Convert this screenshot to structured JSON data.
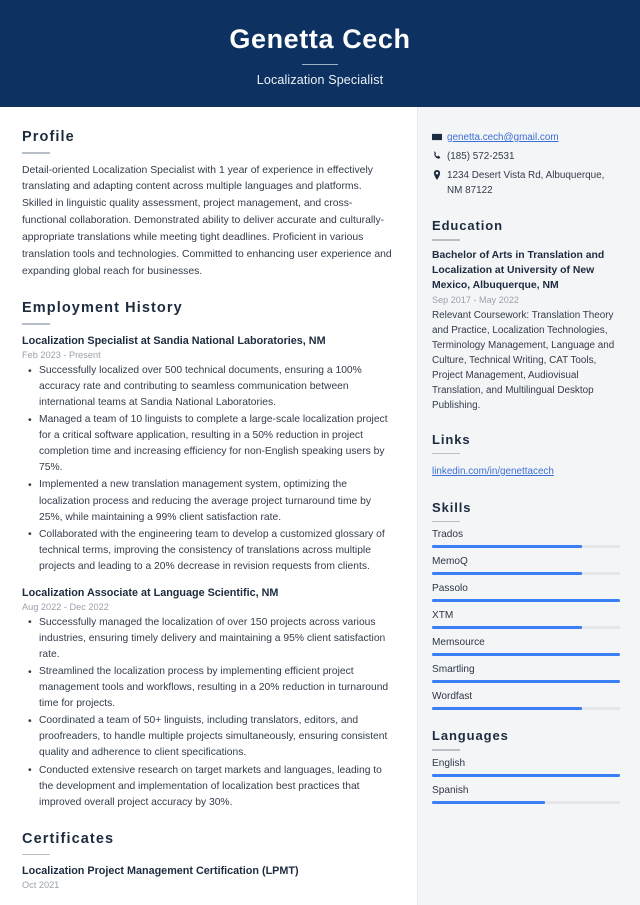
{
  "header": {
    "name": "Genetta Cech",
    "job_title": "Localization Specialist"
  },
  "theme": {
    "navy": "#0d3261",
    "sidebar_bg": "#f4f5f7",
    "accent_blue": "#3b7ff5",
    "link_blue": "#3b6fd4",
    "track_gray": "#e4e6e8"
  },
  "main": {
    "profile": {
      "heading": "Profile",
      "text": "Detail-oriented Localization Specialist with 1 year of experience in effectively translating and adapting content across multiple languages and platforms. Skilled in linguistic quality assessment, project management, and cross-functional collaboration. Demonstrated ability to deliver accurate and culturally-appropriate translations while meeting tight deadlines. Proficient in various translation tools and technologies. Committed to enhancing user experience and expanding global reach for businesses."
    },
    "employment": {
      "heading": "Employment History",
      "jobs": [
        {
          "title": "Localization Specialist at Sandia National Laboratories, NM",
          "date": "Feb 2023 - Present",
          "bullets": [
            "Successfully localized over 500 technical documents, ensuring a 100% accuracy rate and contributing to seamless communication between international teams at Sandia National Laboratories.",
            "Managed a team of 10 linguists to complete a large-scale localization project for a critical software application, resulting in a 50% reduction in project completion time and increasing efficiency for non-English speaking users by 75%.",
            "Implemented a new translation management system, optimizing the localization process and reducing the average project turnaround time by 25%, while maintaining a 99% client satisfaction rate.",
            "Collaborated with the engineering team to develop a customized glossary of technical terms, improving the consistency of translations across multiple projects and leading to a 20% decrease in revision requests from clients."
          ]
        },
        {
          "title": "Localization Associate at Language Scientific, NM",
          "date": "Aug 2022 - Dec 2022",
          "bullets": [
            "Successfully managed the localization of over 150 projects across various industries, ensuring timely delivery and maintaining a 95% client satisfaction rate.",
            "Streamlined the localization process by implementing efficient project management tools and workflows, resulting in a 20% reduction in turnaround time for projects.",
            "Coordinated a team of 50+ linguists, including translators, editors, and proofreaders, to handle multiple projects simultaneously, ensuring consistent quality and adherence to client specifications.",
            "Conducted extensive research on target markets and languages, leading to the development and implementation of localization best practices that improved overall project accuracy by 30%."
          ]
        }
      ]
    },
    "certificates": {
      "heading": "Certificates",
      "items": [
        {
          "title": "Localization Project Management Certification (LPMT)",
          "date": "Oct 2021"
        }
      ]
    }
  },
  "sidebar": {
    "contact": {
      "email": "genetta.cech@gmail.com",
      "phone": "(185) 572-2531",
      "address": "1234 Desert Vista Rd, Albuquerque, NM 87122",
      "icons": {
        "email": "envelope-icon",
        "phone": "phone-icon",
        "address": "location-pin-icon"
      }
    },
    "education": {
      "heading": "Education",
      "degree": "Bachelor of Arts in Translation and Localization at University of New Mexico, Albuquerque, NM",
      "date": "Sep 2017 - May 2022",
      "description": "Relevant Coursework: Translation Theory and Practice, Localization Technologies, Terminology Management, Language and Culture, Technical Writing, CAT Tools, Project Management, Audiovisual Translation, and Multilingual Desktop Publishing."
    },
    "links": {
      "heading": "Links",
      "items": [
        {
          "label": "linkedin.com/in/genettacech"
        }
      ]
    },
    "skills": {
      "heading": "Skills",
      "items": [
        {
          "label": "Trados",
          "level": 80
        },
        {
          "label": "MemoQ",
          "level": 80
        },
        {
          "label": "Passolo",
          "level": 100
        },
        {
          "label": "XTM",
          "level": 80
        },
        {
          "label": "Memsource",
          "level": 100
        },
        {
          "label": "Smartling",
          "level": 100
        },
        {
          "label": "Wordfast",
          "level": 80
        }
      ]
    },
    "languages": {
      "heading": "Languages",
      "items": [
        {
          "label": "English",
          "level": 100
        },
        {
          "label": "Spanish",
          "level": 60
        }
      ]
    }
  }
}
